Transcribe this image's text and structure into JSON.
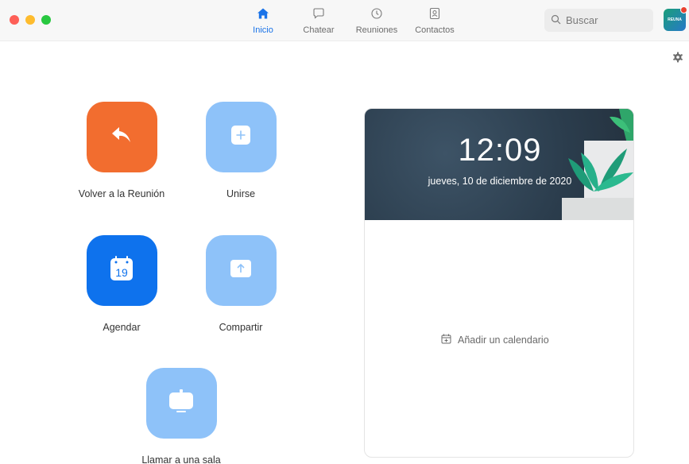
{
  "nav": {
    "tabs": [
      {
        "label": "Inicio",
        "icon": "home-icon",
        "active": true
      },
      {
        "label": "Chatear",
        "icon": "chat-bubble-icon",
        "active": false
      },
      {
        "label": "Reuniones",
        "icon": "clock-icon",
        "active": false
      },
      {
        "label": "Contactos",
        "icon": "contact-card-icon",
        "active": false
      }
    ]
  },
  "search": {
    "placeholder": "Buscar"
  },
  "avatar": {
    "text": "REUNA"
  },
  "actions": [
    {
      "label": "Volver a la Reunión",
      "icon": "return-arrow-icon",
      "color": "#f26d2f"
    },
    {
      "label": "Unirse",
      "icon": "plus-icon",
      "color": "#8ec2f9"
    },
    {
      "label": "Agendar",
      "icon": "calendar-icon",
      "day": "19",
      "color": "#0e72ed"
    },
    {
      "label": "Compartir",
      "icon": "share-up-arrow-icon",
      "color": "#8ec2f9"
    },
    {
      "label": "Llamar a una sala",
      "icon": "monitor-icon",
      "color": "#8ec2f9"
    }
  ],
  "calendar_card": {
    "time": "12:09",
    "date": "jueves, 10 de diciembre de 2020",
    "add_calendar": "Añadir un calendario"
  },
  "colors": {
    "accent": "#1a73e8",
    "zoom_blue": "#0e72ed",
    "light_blue": "#8ec2f9",
    "orange": "#f26d2f"
  }
}
